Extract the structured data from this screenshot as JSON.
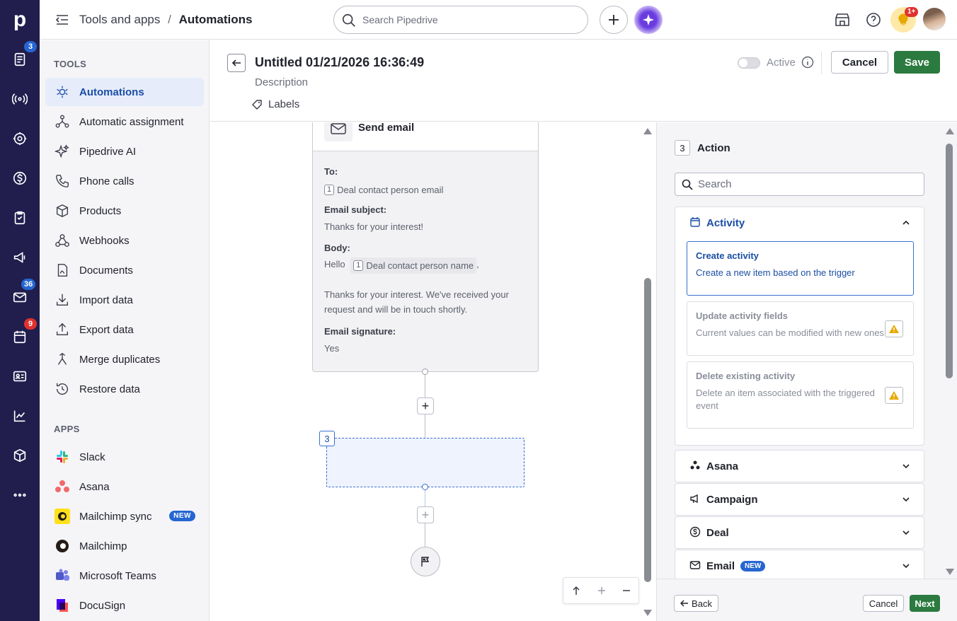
{
  "rail": {
    "logo": "p",
    "badges": {
      "leads": "3",
      "mail": "36",
      "calendar": "9"
    }
  },
  "topbar": {
    "crumb_parent": "Tools and apps",
    "crumb_sep": "/",
    "crumb_current": "Automations",
    "search_placeholder": "Search Pipedrive",
    "notif_badge": "1+"
  },
  "sidebar": {
    "tools_header": "TOOLS",
    "tools": [
      {
        "label": "Automations",
        "icon": "automations-icon"
      },
      {
        "label": "Automatic assignment",
        "icon": "assignment-icon"
      },
      {
        "label": "Pipedrive AI",
        "icon": "sparkle-icon"
      },
      {
        "label": "Phone calls",
        "icon": "phone-icon"
      },
      {
        "label": "Products",
        "icon": "box-icon"
      },
      {
        "label": "Webhooks",
        "icon": "webhook-icon"
      },
      {
        "label": "Documents",
        "icon": "document-icon"
      },
      {
        "label": "Import data",
        "icon": "import-icon"
      },
      {
        "label": "Export data",
        "icon": "export-icon"
      },
      {
        "label": "Merge duplicates",
        "icon": "merge-icon"
      },
      {
        "label": "Restore data",
        "icon": "restore-icon"
      }
    ],
    "apps_header": "APPS",
    "apps": [
      {
        "label": "Slack",
        "icon": "slack-icon"
      },
      {
        "label": "Asana",
        "icon": "asana-icon"
      },
      {
        "label": "Mailchimp sync",
        "icon": "mailchimp-icon",
        "badge": "NEW"
      },
      {
        "label": "Mailchimp",
        "icon": "mailchimp-icon"
      },
      {
        "label": "Microsoft Teams",
        "icon": "teams-icon"
      },
      {
        "label": "DocuSign",
        "icon": "docusign-icon"
      }
    ]
  },
  "editor": {
    "title": "Untitled 01/21/2026 16:36:49",
    "description": "Description",
    "labels": "Labels",
    "active_label": "Active",
    "active_on": false,
    "cancel": "Cancel",
    "save": "Save"
  },
  "canvas": {
    "card_title": "Send email",
    "to_label": "To:",
    "to_token_num": "1",
    "to_token": "Deal contact person email",
    "subject_label": "Email subject:",
    "subject_value": "Thanks for your interest!",
    "body_label": "Body:",
    "body_hello": "Hello",
    "body_token_num": "1",
    "body_token": "Deal contact person name",
    "body_comma": ",",
    "body_text": "Thanks for your interest. We've received your request and will be in touch shortly.",
    "signature_label": "Email signature:",
    "signature_value": "Yes",
    "new_step_number": "3"
  },
  "panel": {
    "step_number": "3",
    "title": "Action",
    "search_placeholder": "Search",
    "activity_group": "Activity",
    "options": [
      {
        "title": "Create activity",
        "desc": "Create a new item based on the trigger",
        "selected": true
      },
      {
        "title": "Update activity fields",
        "desc": "Current values can be modified with new ones",
        "warning": true
      },
      {
        "title": "Delete existing activity",
        "desc": "Delete an item associated with the triggered event",
        "warning": true
      }
    ],
    "groups": [
      {
        "label": "Asana",
        "icon": "asana-icon"
      },
      {
        "label": "Campaign",
        "icon": "megaphone-icon"
      },
      {
        "label": "Deal",
        "icon": "dollar-icon"
      },
      {
        "label": "Email",
        "icon": "mail-icon",
        "badge": "NEW"
      }
    ],
    "back": "Back",
    "cancel": "Cancel",
    "next": "Next"
  },
  "colors": {
    "rail": "#211e4e",
    "save": "#2b7a3f",
    "accent": "#1b4ea5",
    "badge_blue": "#2566d1",
    "badge_red": "#e0312e"
  }
}
